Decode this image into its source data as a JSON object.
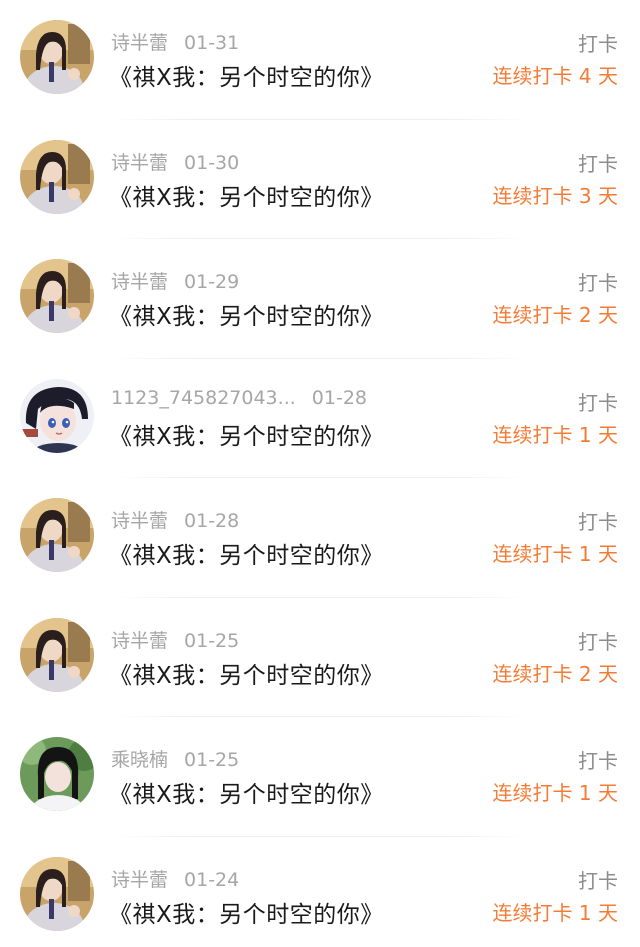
{
  "colors": {
    "accent": "#f47b35",
    "username": "#a6a6a6",
    "title": "#1a1a1a",
    "type": "#8c8c8c"
  },
  "entries": [
    {
      "avatar": "girl-portrait",
      "user": "诗半蕾",
      "date": "01-31",
      "title": "《祺Ⅹ我：另个时空的你》",
      "type": "打卡",
      "streak": "连续打卡 4 天"
    },
    {
      "avatar": "girl-portrait",
      "user": "诗半蕾",
      "date": "01-30",
      "title": "《祺Ⅹ我：另个时空的你》",
      "type": "打卡",
      "streak": "连续打卡 3 天"
    },
    {
      "avatar": "girl-portrait",
      "user": "诗半蕾",
      "date": "01-29",
      "title": "《祺Ⅹ我：另个时空的你》",
      "type": "打卡",
      "streak": "连续打卡 2 天"
    },
    {
      "avatar": "anime-portrait",
      "user": "1123_745827043...",
      "date": "01-28",
      "title": "《祺Ⅹ我：另个时空的你》",
      "type": "打卡",
      "streak": "连续打卡 1 天"
    },
    {
      "avatar": "girl-portrait",
      "user": "诗半蕾",
      "date": "01-28",
      "title": "《祺Ⅹ我：另个时空的你》",
      "type": "打卡",
      "streak": "连续打卡 1 天"
    },
    {
      "avatar": "girl-portrait",
      "user": "诗半蕾",
      "date": "01-25",
      "title": "《祺Ⅹ我：另个时空的你》",
      "type": "打卡",
      "streak": "连续打卡 2 天"
    },
    {
      "avatar": "green-portrait",
      "user": "乘晓楠",
      "date": "01-25",
      "title": "《祺Ⅹ我：另个时空的你》",
      "type": "打卡",
      "streak": "连续打卡 1 天"
    },
    {
      "avatar": "girl-portrait",
      "user": "诗半蕾",
      "date": "01-24",
      "title": "《祺Ⅹ我：另个时空的你》",
      "type": "打卡",
      "streak": "连续打卡 1 天"
    }
  ]
}
